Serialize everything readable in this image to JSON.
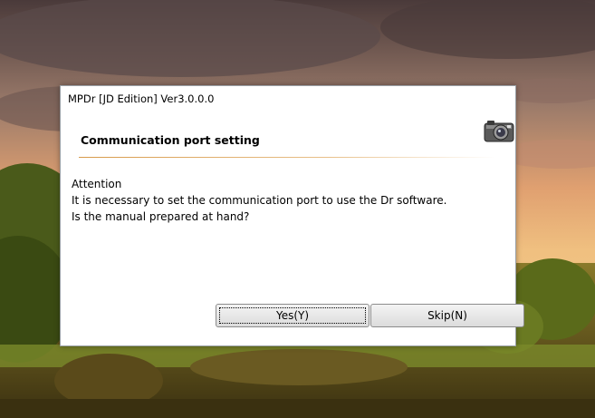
{
  "window": {
    "title": "MPDr [JD Edition] Ver3.0.0.0"
  },
  "dialog": {
    "heading": "Communication port setting",
    "message_lines": [
      "Attention",
      "It is necessary to set the communication port to use the Dr software.",
      "Is the manual prepared at hand?"
    ],
    "header_icon": "camera-icon"
  },
  "buttons": {
    "yes_label": "Yes(Y)",
    "skip_label": "Skip(N)"
  },
  "colors": {
    "accent_rule": "#d79a4a",
    "dialog_bg": "#ffffff",
    "button_face": "#e6e6e6"
  }
}
